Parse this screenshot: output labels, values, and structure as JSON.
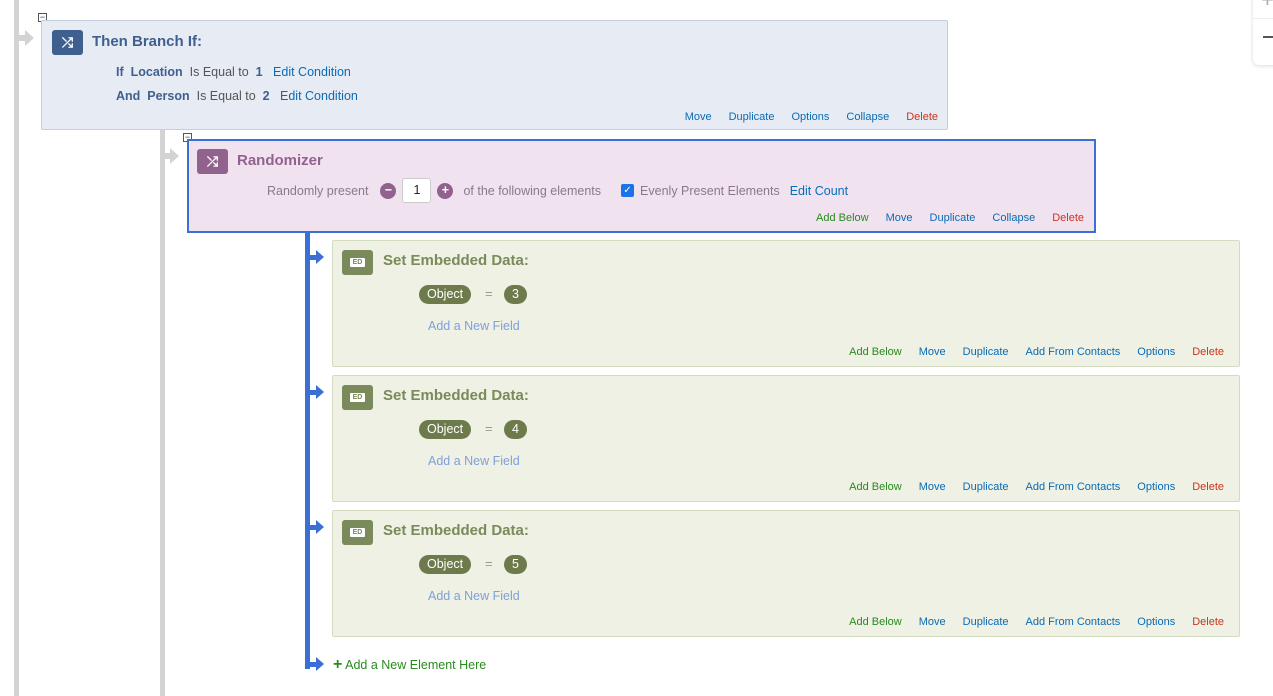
{
  "branch": {
    "title": "Then Branch If:",
    "conditions": [
      {
        "conj": "If",
        "field": "Location",
        "op": "Is Equal to",
        "value": "1",
        "edit": "Edit Condition"
      },
      {
        "conj": "And",
        "field": "Person",
        "op": "Is Equal to",
        "value": "2",
        "edit": "Edit Condition"
      }
    ],
    "actions": {
      "move": "Move",
      "duplicate": "Duplicate",
      "options": "Options",
      "collapse": "Collapse",
      "delete": "Delete"
    }
  },
  "randomizer": {
    "title": "Randomizer",
    "label_pre": "Randomly present",
    "count": "1",
    "label_post": "of the following elements",
    "evenly_label": "Evenly Present Elements",
    "evenly_checked": true,
    "edit_count": "Edit Count",
    "actions": {
      "add_below": "Add Below",
      "move": "Move",
      "duplicate": "Duplicate",
      "collapse": "Collapse",
      "delete": "Delete"
    }
  },
  "embedded": [
    {
      "icon": "ED",
      "title": "Set Embedded Data:",
      "field": "Object",
      "eq": "=",
      "value": "3",
      "add_field": "Add a New Field"
    },
    {
      "icon": "ED",
      "title": "Set Embedded Data:",
      "field": "Object",
      "eq": "=",
      "value": "4",
      "add_field": "Add a New Field"
    },
    {
      "icon": "ED",
      "title": "Set Embedded Data:",
      "field": "Object",
      "eq": "=",
      "value": "5",
      "add_field": "Add a New Field"
    }
  ],
  "embedded_actions": {
    "add_below": "Add Below",
    "move": "Move",
    "duplicate": "Duplicate",
    "add_from_contacts": "Add From Contacts",
    "options": "Options",
    "delete": "Delete"
  },
  "add_element": "Add a New Element Here",
  "colors": {
    "branch": "#3f5f8f",
    "randomizer": "#92628f",
    "embedded": "#6d7a4b",
    "link": "#0a6bb5",
    "delete": "#d0321a",
    "add": "#2a8a1e",
    "selected_border": "#3a6fd6"
  }
}
